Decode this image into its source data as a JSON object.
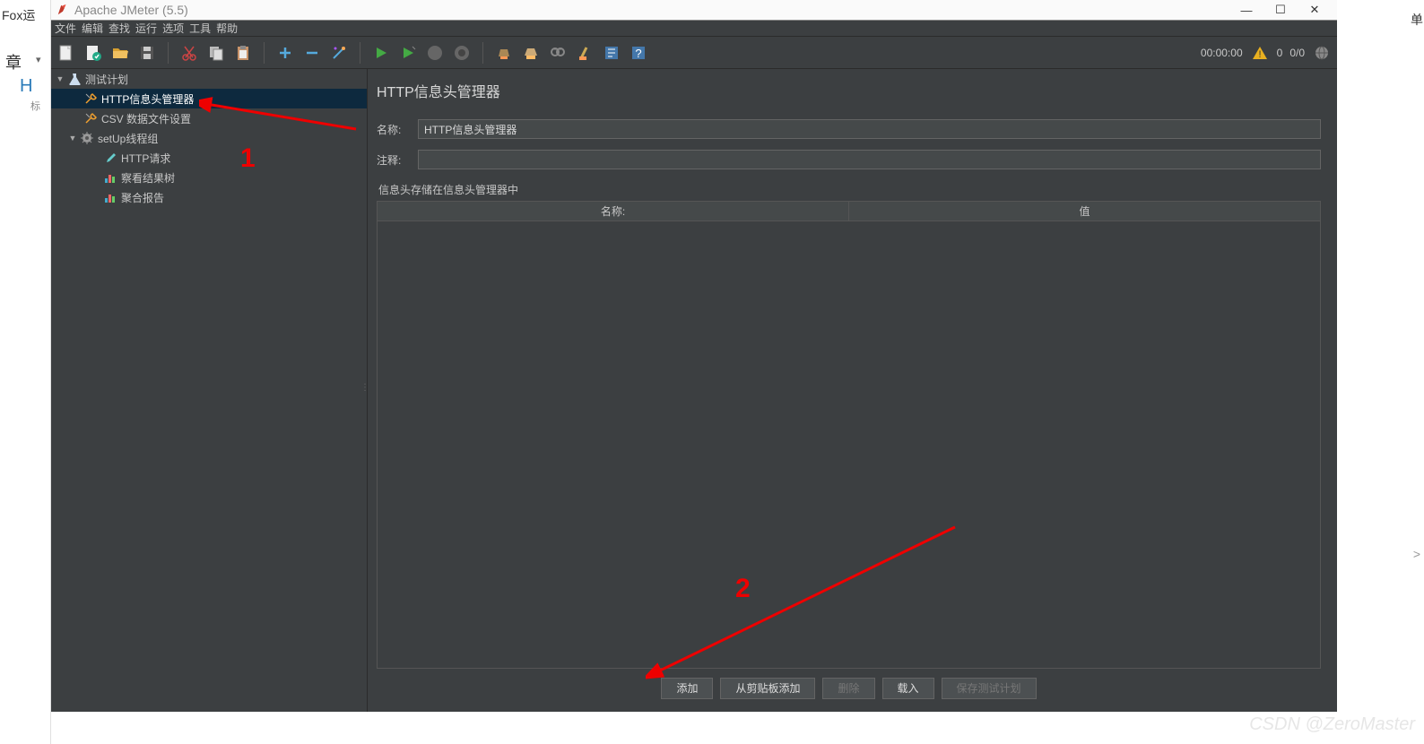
{
  "outer": {
    "fox": "Fox运",
    "chapter": "章",
    "dropdown": "▾",
    "initial": "H",
    "bracket": "标",
    "right": "单",
    "more": ">"
  },
  "title": "Apache JMeter (5.5)",
  "win": {
    "min": "—",
    "max": "☐",
    "close": "✕"
  },
  "menu": [
    "文件",
    "编辑",
    "查找",
    "运行",
    "选项",
    "工具",
    "帮助"
  ],
  "statusRight": {
    "time": "00:00:00",
    "warnCount": "0",
    "threads": "0/0"
  },
  "tree": {
    "root": {
      "label": "测试计划"
    },
    "item1": {
      "label": "HTTP信息头管理器"
    },
    "item2": {
      "label": "CSV 数据文件设置"
    },
    "group": {
      "label": "setUp线程组"
    },
    "child1": {
      "label": "HTTP请求"
    },
    "child2": {
      "label": "察看结果树"
    },
    "child3": {
      "label": "聚合报告"
    }
  },
  "main": {
    "title": "HTTP信息头管理器",
    "nameLabel": "名称:",
    "nameValue": "HTTP信息头管理器",
    "commentLabel": "注释:",
    "commentValue": "",
    "sectionLabel": "信息头存储在信息头管理器中",
    "th1": "名称:",
    "th2": "值",
    "btnAdd": "添加",
    "btnClipboard": "从剪贴板添加",
    "btnDelete": "删除",
    "btnLoad": "载入",
    "btnSavePlan": "保存测试计划"
  },
  "annot": {
    "one": "1",
    "two": "2"
  },
  "watermark": "CSDN @ZeroMaster"
}
